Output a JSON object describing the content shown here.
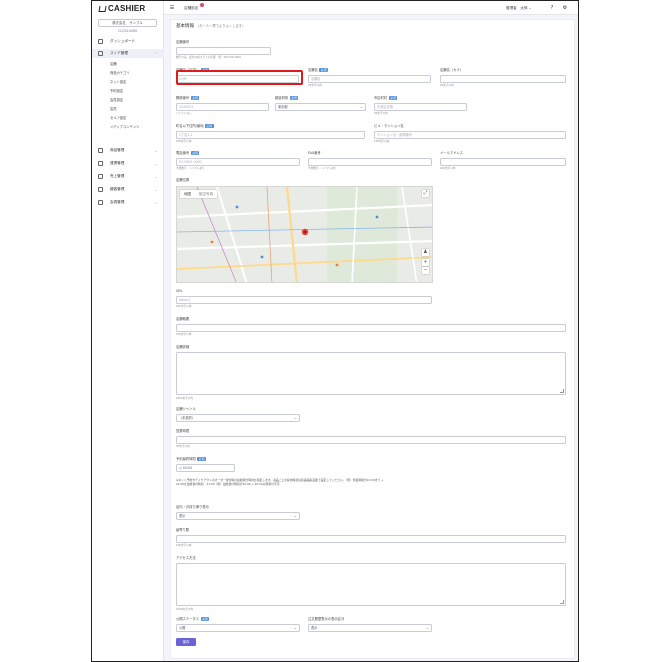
{
  "app": {
    "logo_text": "CASHIER"
  },
  "sidebar": {
    "store_select": "株式会社　サンプル",
    "store_code": "C1234-0000",
    "items": [
      {
        "label": "ダッシュボード",
        "icon": "home-icon"
      },
      {
        "label": "ストア管理",
        "icon": "store-icon"
      },
      {
        "label": "商品管理",
        "icon": "box-icon"
      },
      {
        "label": "連携管理",
        "icon": "link-icon"
      },
      {
        "label": "売上管理",
        "icon": "cart-icon"
      },
      {
        "label": "顧客管理",
        "icon": "user-icon"
      },
      {
        "label": "会員管理",
        "icon": "card-icon"
      }
    ],
    "subitems": [
      "店舗",
      "商品カテゴリ",
      "ネット設定",
      "予約設定",
      "会員設定",
      "店員",
      "セルフ設定",
      "メディアコンテンツ"
    ]
  },
  "topbar": {
    "page_label": "店舗設定",
    "user_label": "管理者　太郎 ⌄"
  },
  "form": {
    "heading": "基本情報",
    "heading_note": "（お一人一票でよりよくします）",
    "required_badge": "必須",
    "fields": {
      "store_code": {
        "label": "店舗番号",
        "hint": "数字のみ、最大10桁まで入力可能　例：TC1234-0000"
      },
      "store_name": {
        "label": "店舗名（正式）",
        "placeholder": "CHPI"
      },
      "store_short": {
        "label": "店舗名",
        "placeholder": "店舗名",
        "hint": "50文字以内"
      },
      "store_kana": {
        "label": "店舗名（カナ）",
        "hint": "50文字以内"
      },
      "postal": {
        "label": "郵便番号",
        "placeholder": "1040031",
        "hint": "ハイフンなし"
      },
      "prefecture": {
        "label": "都道府県",
        "value": "東京都"
      },
      "city": {
        "label": "市区町村",
        "placeholder": "中央区京橋",
        "hint": "50文字以内"
      },
      "address": {
        "label": "町名以下住所/番地",
        "placeholder": "1丁目1-1",
        "hint": "100文字以内"
      },
      "building": {
        "label": "ビル・マンション名",
        "placeholder": "マンション名・部屋番号",
        "hint": "100文字以内"
      },
      "phone": {
        "label": "電話番号",
        "placeholder": "03-0000-0000",
        "hint": "半角数字、ハイフンあり"
      },
      "fax": {
        "label": "FAX番号",
        "hint": "半角数字、ハイフンあり"
      },
      "email": {
        "label": "メールアドレス",
        "hint": "100文字以内"
      },
      "map": {
        "label": "店舗位置",
        "tab_map": "地図",
        "tab_satellite": "航空写真"
      },
      "url": {
        "label": "URL",
        "placeholder": "https://",
        "hint": "100文字以内"
      },
      "summary": {
        "label": "店舗概要",
        "hint": "100文字以内"
      },
      "detail": {
        "label": "店舗詳細",
        "hint": "1000文字以内"
      },
      "genre": {
        "label": "店舗ジャンル",
        "value": "（未選択）",
        "hint": ""
      },
      "hours": {
        "label": "営業時間",
        "hint": "50文字以内"
      },
      "reserve_time": {
        "label": "予約最終時間",
        "value": "00:00"
      },
      "reserve_note": "※ネット予約やテイクアウトのオーダー受付時の最終受付時刻を指定します。商品ごとの締め時刻は商品編集画面で設定してください。（例）営業時間が22:00まで → 21:00を最終受付時刻　21:00（例）最終受付時刻が20:00 → 20:00以降受付不可",
      "eat_in": {
        "label": "店内・お持ち帰り表示",
        "value": "表示"
      },
      "access": {
        "label": "最寄り駅",
        "hint": "100文字以内"
      },
      "access_detail": {
        "label": "アクセス方法",
        "hint": "1000文字以内"
      },
      "publish": {
        "label": "公開ステータス",
        "value": "公開"
      },
      "cart_display": {
        "label": "注文履歴表示の表示区分",
        "value": "表示"
      }
    },
    "submit_label": "保存"
  }
}
